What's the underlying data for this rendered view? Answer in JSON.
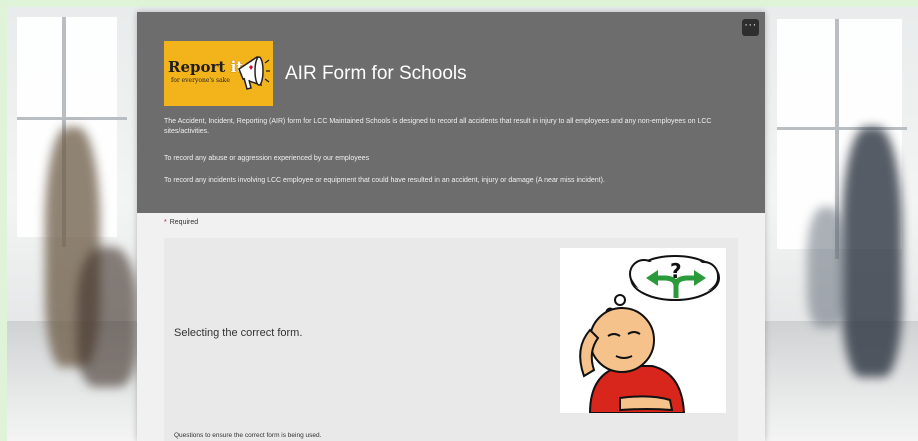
{
  "page": {
    "more_label": "···"
  },
  "logo": {
    "text_report": "Report",
    "text_it": "it",
    "tagline": "for everyone's sake",
    "icon": "megaphone-icon"
  },
  "form": {
    "title": "AIR Form for Schools",
    "description": [
      "The Accident, Incident, Reporting (AIR) form for LCC Maintained Schools is designed to record all accidents that result in injury to all employees and any non-employees on LCC sites/activities.",
      "To record any abuse or aggression experienced by our employees",
      "To record any incidents involving LCC employee or equipment that could have resulted in an accident, injury or damage (A near miss incident)."
    ],
    "required_label": "Required",
    "required_star": "*"
  },
  "section": {
    "title": "Selecting the correct form.",
    "image": "thinking-person-choice-icon",
    "note": "Questions to ensure the correct form is being used."
  },
  "colors": {
    "header_bg": "#6d6d6d",
    "logo_bg": "#f3b31b",
    "required_star": "#c8102e",
    "page_bg": "#dff3d8"
  }
}
